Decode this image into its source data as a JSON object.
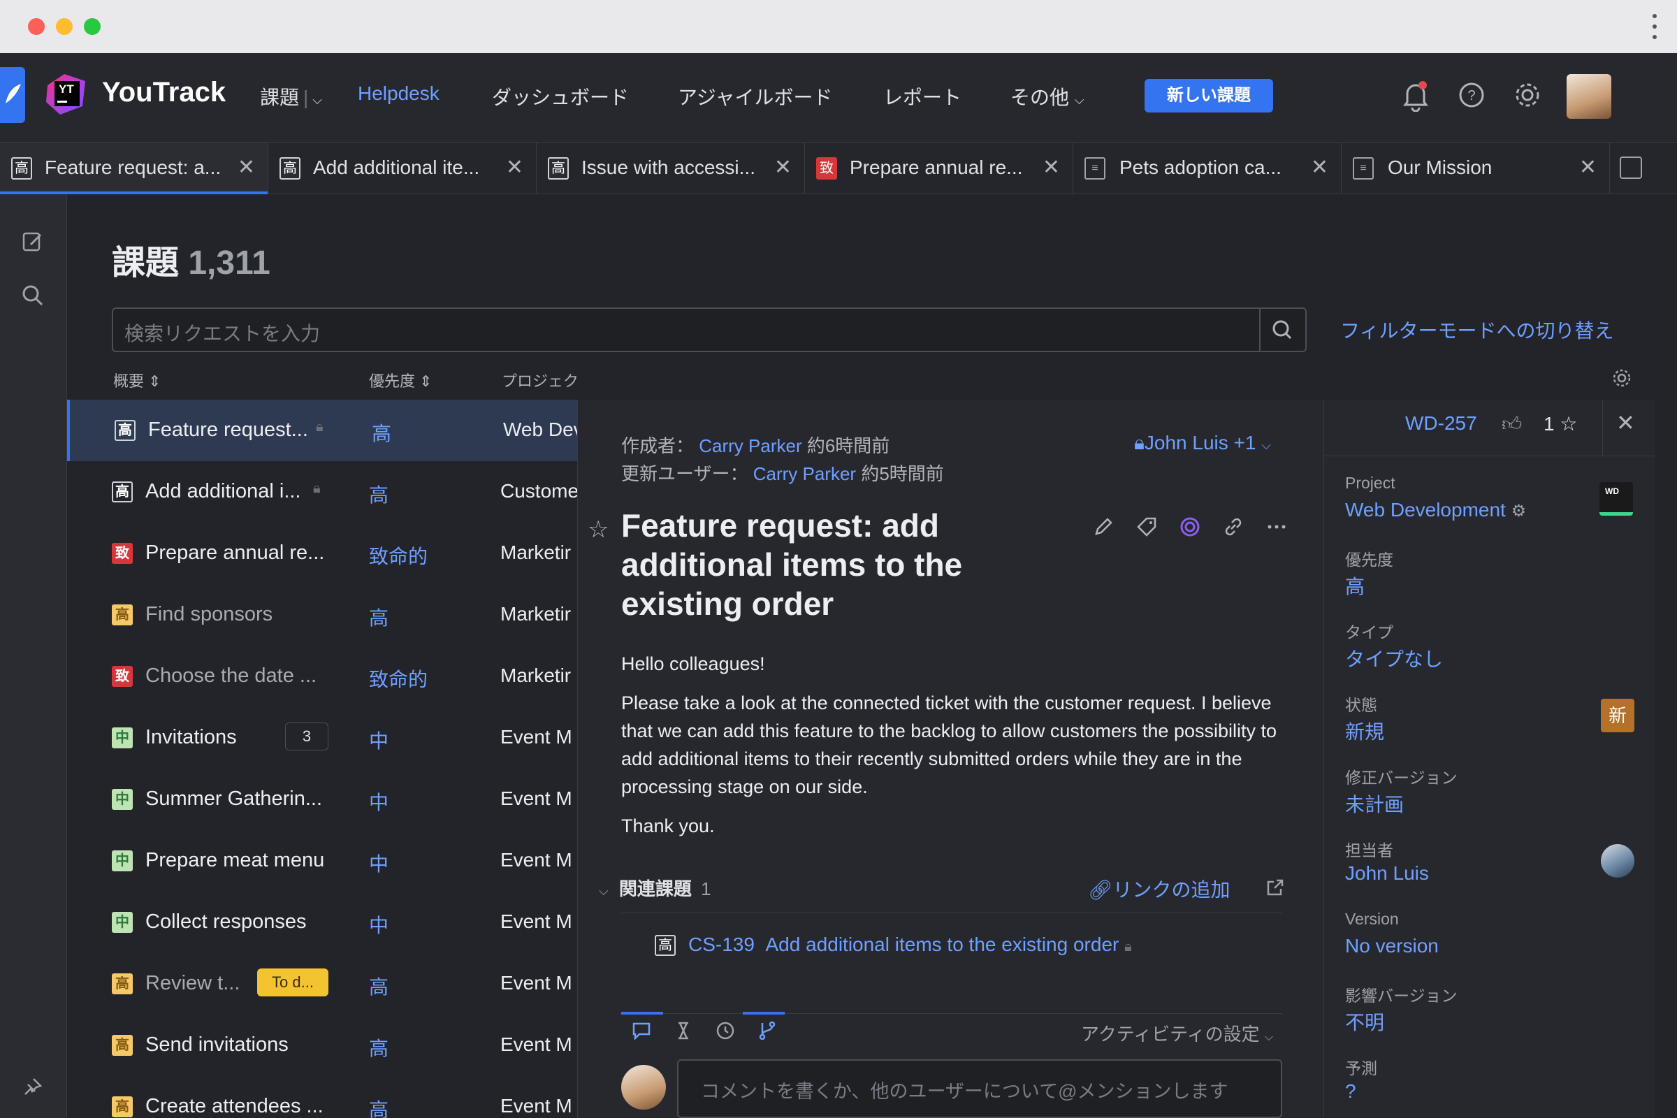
{
  "app": {
    "name": "YouTrack",
    "logo_text": "YT"
  },
  "nav": {
    "issues": "課題",
    "helpdesk": "Helpdesk",
    "dashboards": "ダッシュボード",
    "agile": "アジャイルボード",
    "reports": "レポート",
    "more": "その他",
    "new_issue": "新しい課題"
  },
  "tabs": [
    {
      "label": "Feature request: a...",
      "icon": "高",
      "kind": "high"
    },
    {
      "label": "Add additional ite...",
      "icon": "高",
      "kind": "high"
    },
    {
      "label": "Issue with accessi...",
      "icon": "高",
      "kind": "high"
    },
    {
      "label": "Prepare annual re...",
      "icon": "致",
      "kind": "critical"
    },
    {
      "label": "Pets adoption ca...",
      "icon": "doc",
      "kind": "doc"
    },
    {
      "label": "Our Mission",
      "icon": "doc",
      "kind": "doc"
    }
  ],
  "list": {
    "title": "課題",
    "count": "1,311",
    "search_placeholder": "検索リクエストを入力",
    "filter_mode": "フィルターモードへの切り替え",
    "col_summary": "概要",
    "col_priority": "優先度",
    "col_project": "プロジェクト",
    "rows": [
      {
        "icon": "高",
        "color": "#ffffff",
        "summary": "Feature request...",
        "priority": "高",
        "project": "Web Dev",
        "dim": false
      },
      {
        "icon": "高",
        "color": "#ffffff",
        "summary": "Add additional i...",
        "priority": "高",
        "project": "Custome",
        "dim": false
      },
      {
        "icon": "致",
        "color": "#d6373b",
        "summary": "Prepare annual re...",
        "priority": "致命的",
        "project": "Marketir",
        "dim": false
      },
      {
        "icon": "高",
        "color": "#e8a23b",
        "summary": "Find sponsors",
        "priority": "高",
        "project": "Marketir",
        "dim": true
      },
      {
        "icon": "致",
        "color": "#d6373b",
        "summary": "Choose the date ...",
        "priority": "致命的",
        "project": "Marketir",
        "dim": true
      },
      {
        "icon": "中",
        "color": "#4da85a",
        "summary": "Invitations",
        "priority": "中",
        "project": "Event M",
        "dim": false,
        "badge": "3"
      },
      {
        "icon": "中",
        "color": "#4da85a",
        "summary": "Summer Gatherin...",
        "priority": "中",
        "project": "Event M",
        "dim": false
      },
      {
        "icon": "中",
        "color": "#4da85a",
        "summary": "Prepare meat menu",
        "priority": "中",
        "project": "Event M",
        "dim": false
      },
      {
        "icon": "中",
        "color": "#4da85a",
        "summary": "Collect responses",
        "priority": "中",
        "project": "Event M",
        "dim": false
      },
      {
        "icon": "高",
        "color": "#e8a23b",
        "summary": "Review t...",
        "priority": "高",
        "project": "Event M",
        "dim": true,
        "tag": "To d..."
      },
      {
        "icon": "高",
        "color": "#e8a23b",
        "summary": "Send invitations",
        "priority": "高",
        "project": "Event M",
        "dim": false
      },
      {
        "icon": "高",
        "color": "#e8a23b",
        "summary": "Create attendees ...",
        "priority": "高",
        "project": "Event M",
        "dim": false
      }
    ]
  },
  "detail": {
    "created_label": "作成者：",
    "created_by": "Carry Parker",
    "created_time": "約6時間前",
    "updated_label": "更新ユーザー：",
    "updated_by": "Carry Parker",
    "updated_time": "約5時間前",
    "visibility": "John Luis +1",
    "title": "Feature request: add additional items to the existing order",
    "greeting": "Hello colleagues!",
    "paragraph": "Please take a look at the connected ticket with the customer request. I believe that we can add this feature to the backlog to allow customers the possibility to add additional items to their recently submitted orders while they are in the processing stage on our side.",
    "thanks": "Thank you.",
    "linked_label": "関連課題",
    "linked_count": "1",
    "add_link": "リンクの追加",
    "linked_id": "CS-139",
    "linked_title": "Add additional items to the existing order",
    "activity_settings": "アクティビティの設定",
    "comment_placeholder": "コメントを書くか、他のユーザーについて@メンションします"
  },
  "fields": {
    "issue_id": "WD-257",
    "star_count": "1",
    "project_label": "Project",
    "project": "Web Development",
    "project_badge": "WD",
    "priority_label": "優先度",
    "priority": "高",
    "type_label": "タイプ",
    "type": "タイプなし",
    "state_label": "状態",
    "state": "新規",
    "state_badge": "新",
    "fix_label": "修正バージョン",
    "fix": "未計画",
    "assignee_label": "担当者",
    "assignee": "John Luis",
    "version_label": "Version",
    "version": "No version",
    "affected_label": "影響バージョン",
    "affected": "不明",
    "estimate_label": "予測",
    "estimate": "?"
  },
  "colors": {
    "accent": "#3574f0",
    "link": "#6fa0ff",
    "critical": "#d6373b",
    "high": "#e8a23b",
    "normal": "#4da85a"
  }
}
